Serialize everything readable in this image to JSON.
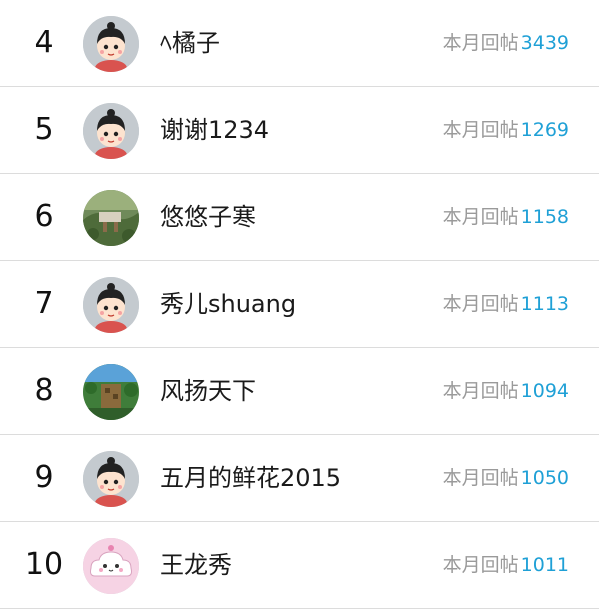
{
  "leaderboard": {
    "stat_label": "本月回帖",
    "value_color": "#1fa0d6",
    "rows": [
      {
        "rank": "4",
        "name": "ﾍ橘子",
        "posts": "3439",
        "avatar": "girl-avatar-icon"
      },
      {
        "rank": "5",
        "name": "谢谢1234",
        "posts": "1269",
        "avatar": "girl-avatar-icon"
      },
      {
        "rank": "6",
        "name": "悠悠子寒",
        "posts": "1158",
        "avatar": "photo-avatar-icon"
      },
      {
        "rank": "7",
        "name": "秀儿shuang",
        "posts": "1113",
        "avatar": "girl-avatar-icon"
      },
      {
        "rank": "8",
        "name": "风扬天下",
        "posts": "1094",
        "avatar": "landscape-avatar-icon"
      },
      {
        "rank": "9",
        "name": "五月的鲜花2015",
        "posts": "1050",
        "avatar": "girl-avatar-icon"
      },
      {
        "rank": "10",
        "name": "王龙秀",
        "posts": "1011",
        "avatar": "cloud-avatar-icon"
      }
    ]
  }
}
